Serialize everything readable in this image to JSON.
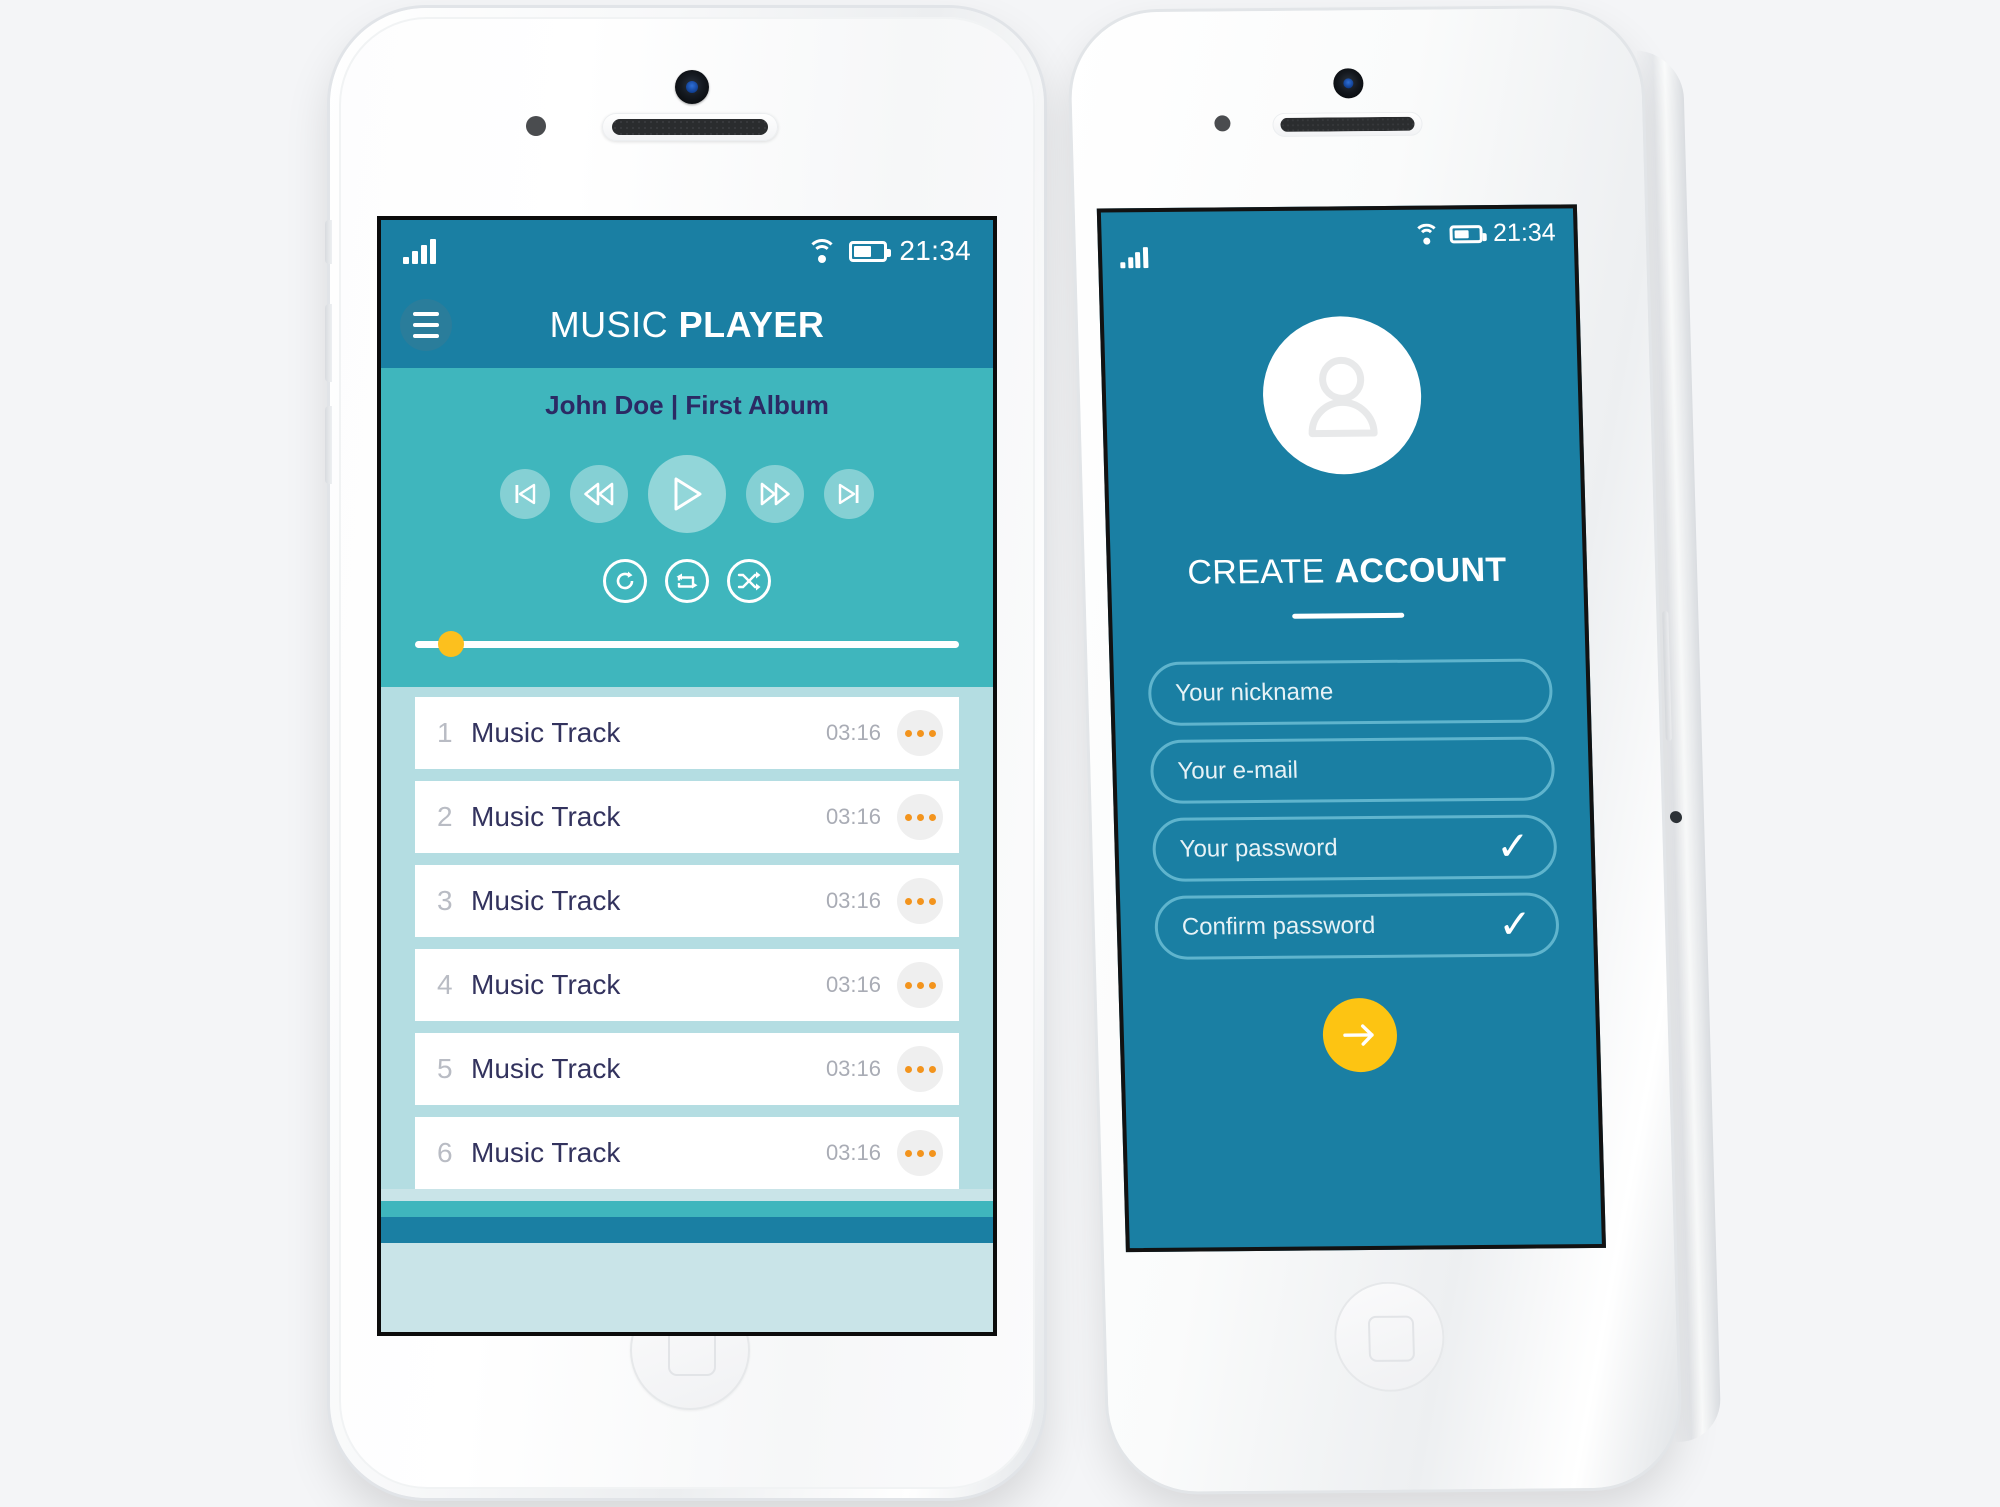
{
  "phone_left": {
    "status_bar": {
      "signal_icon": "signal-bars-icon",
      "wifi_icon": "wifi-icon",
      "battery_icon": "battery-icon",
      "time": "21:34"
    },
    "app_bar": {
      "menu_icon": "hamburger-menu-icon",
      "title_light": "MUSIC",
      "title_bold": "PLAYER"
    },
    "player": {
      "now_playing": "John Doe | First Album",
      "controls": [
        {
          "name": "skip-to-start-button",
          "icon": "skip-previous-icon"
        },
        {
          "name": "rewind-button",
          "icon": "rewind-icon"
        },
        {
          "name": "play-button",
          "icon": "play-icon"
        },
        {
          "name": "fast-forward-button",
          "icon": "fast-forward-icon"
        },
        {
          "name": "skip-to-end-button",
          "icon": "skip-next-icon"
        }
      ],
      "modes": [
        {
          "name": "repeat-one-button",
          "icon": "repeat-one-circle-icon"
        },
        {
          "name": "repeat-all-button",
          "icon": "repeat-circle-icon"
        },
        {
          "name": "shuffle-button",
          "icon": "shuffle-circle-icon"
        }
      ],
      "progress_percent": 4,
      "thumb_color": "#fcc01e"
    },
    "tracks": [
      {
        "number": "1",
        "name": "Music Track",
        "duration": "03:16",
        "menu_icon": "more-options-icon"
      },
      {
        "number": "2",
        "name": "Music Track",
        "duration": "03:16",
        "menu_icon": "more-options-icon"
      },
      {
        "number": "3",
        "name": "Music Track",
        "duration": "03:16",
        "menu_icon": "more-options-icon"
      },
      {
        "number": "4",
        "name": "Music Track",
        "duration": "03:16",
        "menu_icon": "more-options-icon"
      },
      {
        "number": "5",
        "name": "Music Track",
        "duration": "03:16",
        "menu_icon": "more-options-icon"
      },
      {
        "number": "6",
        "name": "Music Track",
        "duration": "03:16",
        "menu_icon": "more-options-icon"
      }
    ]
  },
  "phone_right": {
    "status_bar": {
      "signal_icon": "signal-bars-icon",
      "wifi_icon": "wifi-icon",
      "battery_icon": "battery-icon",
      "time": "21:34"
    },
    "avatar_icon": "user-avatar-icon",
    "title_light": "CREATE",
    "title_bold": "ACCOUNT",
    "fields": [
      {
        "name": "nickname-field",
        "placeholder": "Your nickname",
        "valid": false
      },
      {
        "name": "email-field",
        "placeholder": "Your e-mail",
        "valid": false
      },
      {
        "name": "password-field",
        "placeholder": "Your password",
        "valid": true,
        "check": "✓"
      },
      {
        "name": "confirm-password-field",
        "placeholder": "Confirm password",
        "valid": true,
        "check": "✓"
      }
    ],
    "submit": {
      "name": "submit-button",
      "icon": "arrow-right-icon",
      "color": "#fdc412"
    }
  },
  "theme": {
    "dark_blue": "#1a7fa3",
    "teal": "#3fb6bd",
    "light_blue": "#b4dde2",
    "navy_text": "#33335e",
    "accent_yellow": "#fdc412",
    "accent_orange": "#f3941d"
  }
}
